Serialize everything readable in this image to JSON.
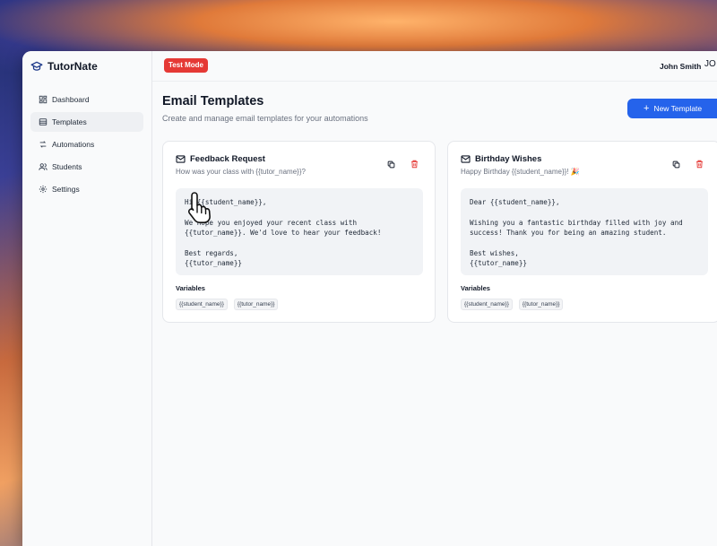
{
  "app": {
    "name": "TutorNate"
  },
  "sidebar": {
    "items": [
      {
        "label": "Dashboard",
        "icon": "dashboard-icon"
      },
      {
        "label": "Templates",
        "icon": "templates-icon",
        "active": true
      },
      {
        "label": "Automations",
        "icon": "automations-icon"
      },
      {
        "label": "Students",
        "icon": "users-icon"
      },
      {
        "label": "Settings",
        "icon": "gear-icon"
      }
    ]
  },
  "topbar": {
    "badge": "Test Mode",
    "user_name": "John Smith",
    "avatar_initials": "JO"
  },
  "page": {
    "title": "Email Templates",
    "subtitle": "Create and manage email templates for your automations",
    "new_button": "New Template"
  },
  "templates": [
    {
      "title": "Feedback Request",
      "subject": "How was your class with {{tutor_name}}?",
      "body": "Hi {{student_name}},\n\nWe hope you enjoyed your recent class with\n{{tutor_name}}. We'd love to hear your feedback!\n\nBest regards,\n{{tutor_name}}",
      "variables_label": "Variables",
      "variables": [
        "{{student_name}}",
        "{{tutor_name}}"
      ]
    },
    {
      "title": "Birthday Wishes",
      "subject": "Happy Birthday {{student_name}}! 🎉",
      "body": "Dear {{student_name}},\n\nWishing you a fantastic birthday filled with joy and\nsuccess! Thank you for being an amazing student.\n\nBest wishes,\n{{tutor_name}}",
      "variables_label": "Variables",
      "variables": [
        "{{student_name}}",
        "{{tutor_name}}"
      ]
    }
  ],
  "colors": {
    "accent": "#2563eb",
    "danger": "#e53935",
    "badge": "#e53935"
  }
}
